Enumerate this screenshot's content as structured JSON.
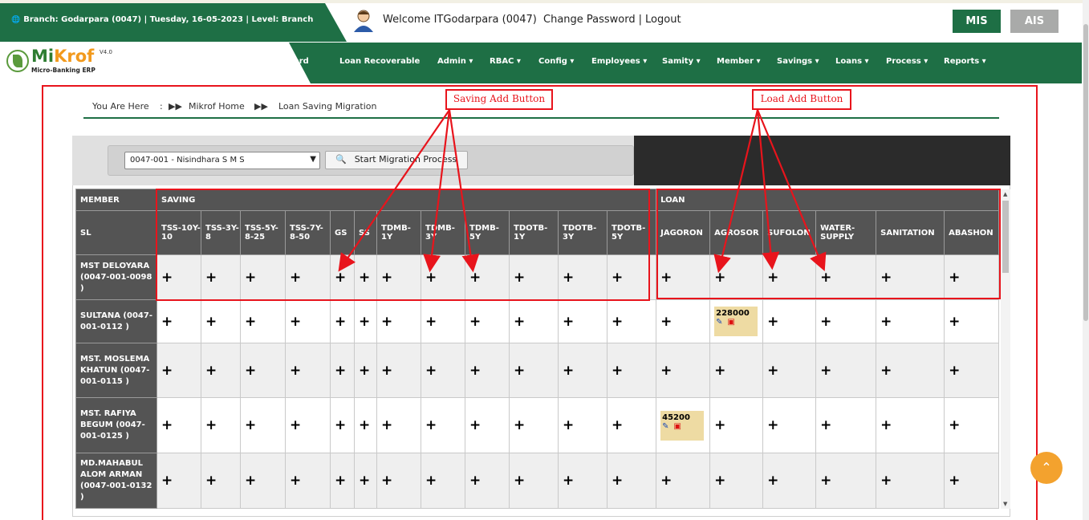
{
  "header": {
    "branch_info": "Branch: Godarpara (0047) | Tuesday, 16-05-2023 | Level: Branch",
    "welcome": "Welcome ITGodarpara (0047)",
    "change_password": "Change Password",
    "separator": "|",
    "logout": "Logout",
    "mis_label": "MIS",
    "ais_label": "AIS"
  },
  "logo": {
    "name_a": "Mi",
    "name_b": "Krof",
    "version": "V4.0",
    "subtitle": "Micro-Banking ERP"
  },
  "nav": {
    "items": [
      "ard",
      "Loan Recoverable",
      "Admin",
      "RBAC",
      "Config",
      "Employees",
      "Samity",
      "Member",
      "Savings",
      "Loans",
      "Process",
      "Reports"
    ]
  },
  "breadcrumb": {
    "prefix": "You Are Here",
    "colon": ":",
    "home": "Mikrof Home",
    "current": "Loan Saving Migration"
  },
  "annotations": {
    "saving": "Saving Add Button",
    "loan": "Load Add Button"
  },
  "filter": {
    "samity_selected": "0047-001 - Nisindhara S M S",
    "start_button": "Start Migration Process"
  },
  "table": {
    "group_member": "MEMBER",
    "group_saving": "SAVING",
    "group_loan": "LOAN",
    "sl_header": "SL",
    "saving_columns": [
      "TSS-10Y-10",
      "TSS-3Y-8",
      "TSS-5Y-8-25",
      "TSS-7Y-8-50",
      "GS",
      "SS",
      "TDMB-1Y",
      "TDMB-3Y",
      "TDMB-5Y",
      "TDOTB-1Y",
      "TDOTB-3Y",
      "TDOTB-5Y"
    ],
    "loan_columns": [
      "JAGORON",
      "AGROSOR",
      "SUFOLON",
      "WATER-SUPPLY",
      "SANITATION",
      "ABASHON"
    ],
    "add_symbol": "+",
    "rows": [
      {
        "member": "MST DELOYARA (0047-001-0098 )"
      },
      {
        "member": "SULTANA (0047-001-0112 )",
        "loan_amount": "228000"
      },
      {
        "member": "MST. MOSLEMA KHATUN (0047-001-0115 )"
      },
      {
        "member": "MST. RAFIYA BEGUM (0047-001-0125 )",
        "loan_amount": "45200"
      },
      {
        "member": "MD.MAHABUL ALOM ARMAN (0047-001-0132 )"
      }
    ]
  },
  "icons": [
    "globe-icon",
    "user-avatar-icon",
    "search-icon",
    "edit-icon",
    "delete-icon",
    "arrow-up-icon"
  ],
  "colors": {
    "brand_green": "#1e6f45",
    "annotation_red": "#e8141c",
    "scroll_top_orange": "#f3a22e"
  }
}
